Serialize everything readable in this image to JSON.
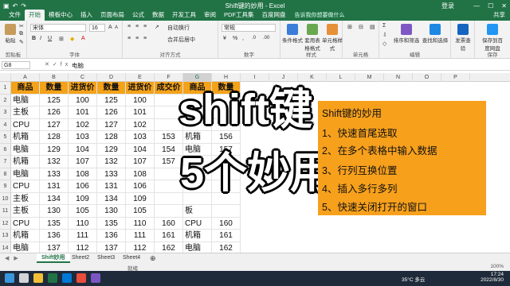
{
  "window": {
    "title": "Shift键的妙用 - Excel",
    "search_placeholder": "告诉我你想要做什么",
    "user": "登录",
    "share": "共享"
  },
  "menu": [
    "文件",
    "开始",
    "模板中心",
    "插入",
    "页面布局",
    "公式",
    "数据",
    "开发工具",
    "审阅",
    "PDF工具集",
    "百度网盘"
  ],
  "ribbon": {
    "paste": "粘贴",
    "clipboard": "剪贴板",
    "font_name": "宋体",
    "font_size": "16",
    "font": "字体",
    "wrap": "自动换行",
    "merge": "合并后居中",
    "alignment": "对齐方式",
    "number_format": "常规",
    "number": "数字",
    "cond_format": "条件格式",
    "table_format": "套用表格格式",
    "cell_style": "单元格样式",
    "styles": "样式",
    "cells": "单元格",
    "sort": "排序和筛选",
    "find": "查找和选择",
    "editing": "编辑",
    "send": "发票查验",
    "save_cloud": "保存到百度网盘",
    "save_group": "保存"
  },
  "formula": {
    "namebox": "G8",
    "fx": "fx",
    "value": "电脑"
  },
  "columns": [
    "A",
    "B",
    "C",
    "D",
    "E",
    "F",
    "G",
    "H",
    "I",
    "J",
    "K",
    "L",
    "M",
    "N",
    "O",
    "P"
  ],
  "rows": [
    "1",
    "2",
    "3",
    "4",
    "5",
    "6",
    "7",
    "8",
    "9",
    "10",
    "11",
    "12",
    "13",
    "14",
    "15",
    "16"
  ],
  "table": {
    "headers": [
      "商品",
      "数量",
      "进货价",
      "数量",
      "进货价",
      "成交价",
      "商品",
      "数量"
    ],
    "data": [
      [
        "电脑",
        "125",
        "100",
        "125",
        "100",
        "",
        "",
        ""
      ],
      [
        "主板",
        "126",
        "101",
        "126",
        "101",
        "",
        "",
        ""
      ],
      [
        "CPU",
        "127",
        "102",
        "127",
        "102",
        "",
        "",
        ""
      ],
      [
        "机箱",
        "128",
        "103",
        "128",
        "103",
        "153",
        "机箱",
        "156"
      ],
      [
        "电脑",
        "129",
        "104",
        "129",
        "104",
        "154",
        "电脑",
        "157"
      ],
      [
        "机箱",
        "132",
        "107",
        "132",
        "107",
        "157",
        "机箱",
        "157"
      ],
      [
        "电脑",
        "133",
        "108",
        "133",
        "108",
        "",
        "",
        ""
      ],
      [
        "CPU",
        "131",
        "106",
        "131",
        "106",
        "",
        "",
        ""
      ],
      [
        "主板",
        "134",
        "109",
        "134",
        "109",
        "",
        "",
        ""
      ],
      [
        "主板",
        "130",
        "105",
        "130",
        "105",
        "",
        "板",
        ""
      ],
      [
        "CPU",
        "135",
        "110",
        "135",
        "110",
        "160",
        "CPU",
        "160"
      ],
      [
        "机箱",
        "136",
        "111",
        "136",
        "111",
        "161",
        "机箱",
        "161"
      ],
      [
        "电脑",
        "137",
        "112",
        "137",
        "112",
        "162",
        "电脑",
        "162"
      ],
      [
        "主板",
        "138",
        "113",
        "138",
        "113",
        "163",
        "主板",
        "163"
      ],
      [
        "CPU",
        "139",
        "114",
        "139",
        "114",
        "164",
        "CPU",
        "164"
      ]
    ]
  },
  "overlay": {
    "line1": "shift键",
    "line2": "5个妙用"
  },
  "panel": {
    "title": "Shift键的妙用",
    "items": [
      "1、快速首尾选取",
      "2、在多个表格中输入数据",
      "3、行列互换位置",
      "4、插入多行多列",
      "5、快速关闭打开的窗口"
    ]
  },
  "sheets": [
    "Shift妙用",
    "Sheet2",
    "Sheet3",
    "Sheet4"
  ],
  "status": {
    "ready": "就绪",
    "zoom": "100%"
  },
  "taskbar": {
    "weather": "35°C 多云",
    "time": "17:24",
    "date": "2022/8/30"
  },
  "colors": {
    "excel_green": "#217346",
    "header_orange": "#f4a21a",
    "panel_orange": "#f7a01c"
  }
}
